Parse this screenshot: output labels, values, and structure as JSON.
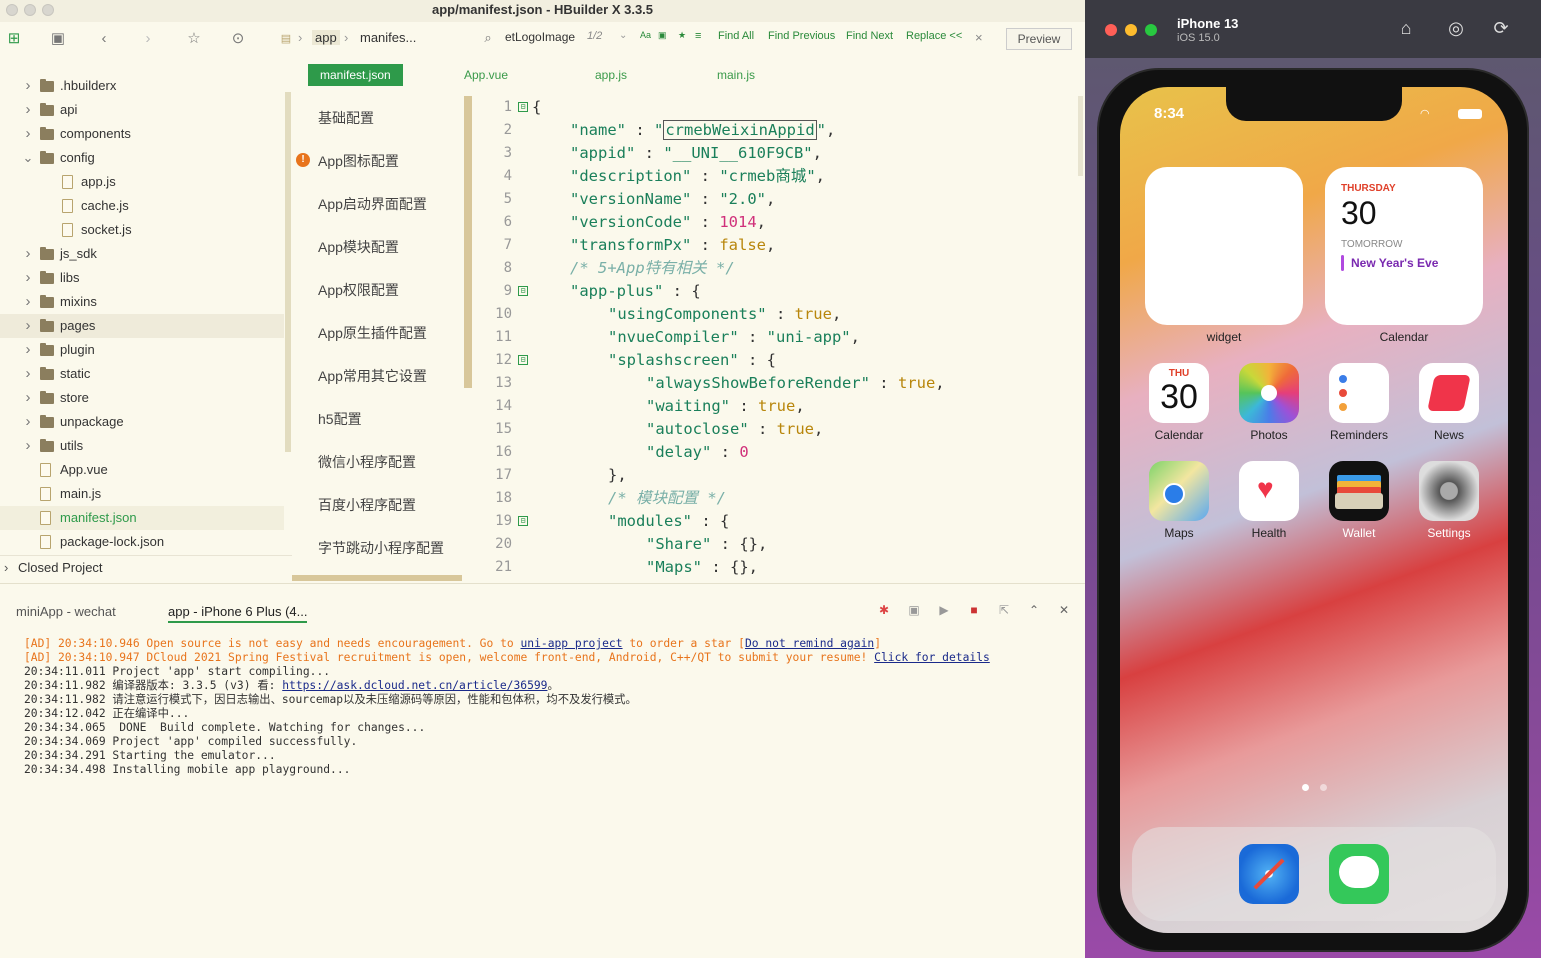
{
  "window": {
    "title": "app/manifest.json - HBuilder X 3.3.5"
  },
  "toolbar": {
    "breadcrumb": [
      "app",
      "manifes..."
    ],
    "search_value": "etLogoImage",
    "match_count": "1/2",
    "opts": [
      "Aa",
      "▣",
      "★",
      "≡"
    ],
    "find_all": "Find All",
    "find_prev": "Find Previous",
    "find_next": "Find Next",
    "replace": "Replace <<",
    "close": "×",
    "preview": "Preview"
  },
  "tree": {
    "items": [
      {
        "label": ".hbuilderx",
        "type": "folder",
        "depth": 0,
        "expanded": false
      },
      {
        "label": "api",
        "type": "folder",
        "depth": 0,
        "expanded": false
      },
      {
        "label": "components",
        "type": "folder",
        "depth": 0,
        "expanded": false
      },
      {
        "label": "config",
        "type": "folder",
        "depth": 0,
        "expanded": true
      },
      {
        "label": "app.js",
        "type": "file",
        "depth": 1
      },
      {
        "label": "cache.js",
        "type": "file",
        "depth": 1
      },
      {
        "label": "socket.js",
        "type": "file",
        "depth": 1
      },
      {
        "label": "js_sdk",
        "type": "folder",
        "depth": 0,
        "expanded": false
      },
      {
        "label": "libs",
        "type": "folder",
        "depth": 0,
        "expanded": false
      },
      {
        "label": "mixins",
        "type": "folder",
        "depth": 0,
        "expanded": false
      },
      {
        "label": "pages",
        "type": "folder",
        "depth": 0,
        "expanded": false,
        "hover": true
      },
      {
        "label": "plugin",
        "type": "folder",
        "depth": 0,
        "expanded": false
      },
      {
        "label": "static",
        "type": "folder",
        "depth": 0,
        "expanded": false
      },
      {
        "label": "store",
        "type": "folder",
        "depth": 0,
        "expanded": false
      },
      {
        "label": "unpackage",
        "type": "folder",
        "depth": 0,
        "expanded": false
      },
      {
        "label": "utils",
        "type": "folder",
        "depth": 0,
        "expanded": false
      },
      {
        "label": "App.vue",
        "type": "file",
        "depth": 0
      },
      {
        "label": "main.js",
        "type": "file",
        "depth": 0
      },
      {
        "label": "manifest.json",
        "type": "file",
        "depth": 0,
        "selected": true
      },
      {
        "label": "package-lock.json",
        "type": "file",
        "depth": 0
      }
    ],
    "closed_project": "Closed Project"
  },
  "tabs": [
    {
      "label": "manifest.json",
      "active": true
    },
    {
      "label": "App.vue"
    },
    {
      "label": "app.js"
    },
    {
      "label": "main.js"
    }
  ],
  "config_nav": [
    {
      "label": "基础配置"
    },
    {
      "label": "App图标配置",
      "warning": true
    },
    {
      "label": "App启动界面配置"
    },
    {
      "label": "App模块配置"
    },
    {
      "label": "App权限配置"
    },
    {
      "label": "App原生插件配置"
    },
    {
      "label": "App常用其它设置"
    },
    {
      "label": "h5配置"
    },
    {
      "label": "微信小程序配置"
    },
    {
      "label": "百度小程序配置"
    },
    {
      "label": "字节跳动小程序配置"
    }
  ],
  "code": [
    {
      "n": "1",
      "fold": "⊟",
      "indent": 0,
      "parts": [
        [
          "p",
          "{"
        ]
      ]
    },
    {
      "n": "2",
      "indent": 1,
      "parts": [
        [
          "k",
          "\"name\""
        ],
        [
          "p",
          " : "
        ],
        [
          "s",
          "\""
        ],
        [
          "hl",
          "crmebWeixinAppid"
        ],
        [
          "s",
          "\""
        ],
        [
          "p",
          ","
        ]
      ]
    },
    {
      "n": "3",
      "indent": 1,
      "parts": [
        [
          "k",
          "\"appid\""
        ],
        [
          "p",
          " : "
        ],
        [
          "s",
          "\"__UNI__610F9CB\""
        ],
        [
          "p",
          ","
        ]
      ]
    },
    {
      "n": "4",
      "indent": 1,
      "parts": [
        [
          "k",
          "\"description\""
        ],
        [
          "p",
          " : "
        ],
        [
          "s",
          "\"crmeb商城\""
        ],
        [
          "p",
          ","
        ]
      ]
    },
    {
      "n": "5",
      "indent": 1,
      "parts": [
        [
          "k",
          "\"versionName\""
        ],
        [
          "p",
          " : "
        ],
        [
          "s",
          "\"2.0\""
        ],
        [
          "p",
          ","
        ]
      ]
    },
    {
      "n": "6",
      "indent": 1,
      "parts": [
        [
          "k",
          "\"versionCode\""
        ],
        [
          "p",
          " : "
        ],
        [
          "n",
          "1014"
        ],
        [
          "p",
          ","
        ]
      ]
    },
    {
      "n": "7",
      "indent": 1,
      "parts": [
        [
          "k",
          "\"transformPx\""
        ],
        [
          "p",
          " : "
        ],
        [
          "b",
          "false"
        ],
        [
          "p",
          ","
        ]
      ]
    },
    {
      "n": "8",
      "indent": 1,
      "parts": [
        [
          "c",
          "/* 5+App特有相关 */"
        ]
      ]
    },
    {
      "n": "9",
      "fold": "⊟",
      "indent": 1,
      "parts": [
        [
          "k",
          "\"app-plus\""
        ],
        [
          "p",
          " : {"
        ]
      ]
    },
    {
      "n": "10",
      "indent": 2,
      "parts": [
        [
          "k",
          "\"usingComponents\""
        ],
        [
          "p",
          " : "
        ],
        [
          "b",
          "true"
        ],
        [
          "p",
          ","
        ]
      ]
    },
    {
      "n": "11",
      "indent": 2,
      "parts": [
        [
          "k",
          "\"nvueCompiler\""
        ],
        [
          "p",
          " : "
        ],
        [
          "s",
          "\"uni-app\""
        ],
        [
          "p",
          ","
        ]
      ]
    },
    {
      "n": "12",
      "fold": "⊟",
      "indent": 2,
      "parts": [
        [
          "k",
          "\"splashscreen\""
        ],
        [
          "p",
          " : {"
        ]
      ]
    },
    {
      "n": "13",
      "indent": 3,
      "parts": [
        [
          "k",
          "\"alwaysShowBeforeRender\""
        ],
        [
          "p",
          " : "
        ],
        [
          "b",
          "true"
        ],
        [
          "p",
          ","
        ]
      ]
    },
    {
      "n": "14",
      "indent": 3,
      "parts": [
        [
          "k",
          "\"waiting\""
        ],
        [
          "p",
          " : "
        ],
        [
          "b",
          "true"
        ],
        [
          "p",
          ","
        ]
      ]
    },
    {
      "n": "15",
      "indent": 3,
      "parts": [
        [
          "k",
          "\"autoclose\""
        ],
        [
          "p",
          " : "
        ],
        [
          "b",
          "true"
        ],
        [
          "p",
          ","
        ]
      ]
    },
    {
      "n": "16",
      "indent": 3,
      "parts": [
        [
          "k",
          "\"delay\""
        ],
        [
          "p",
          " : "
        ],
        [
          "n",
          "0"
        ]
      ]
    },
    {
      "n": "17",
      "indent": 2,
      "parts": [
        [
          "p",
          "},"
        ]
      ]
    },
    {
      "n": "18",
      "indent": 2,
      "parts": [
        [
          "c",
          "/* 模块配置 */"
        ]
      ]
    },
    {
      "n": "19",
      "fold": "⊟",
      "indent": 2,
      "parts": [
        [
          "k",
          "\"modules\""
        ],
        [
          "p",
          " : {"
        ]
      ]
    },
    {
      "n": "20",
      "indent": 3,
      "parts": [
        [
          "k",
          "\"Share\""
        ],
        [
          "p",
          " : {},"
        ]
      ]
    },
    {
      "n": "21",
      "indent": 3,
      "parts": [
        [
          "k",
          "\"Maps\""
        ],
        [
          "p",
          " : {},"
        ]
      ]
    }
  ],
  "console_tabs": [
    {
      "label": "miniApp - wechat"
    },
    {
      "label": "app - iPhone 6 Plus (4...",
      "active": true
    }
  ],
  "console": [
    {
      "cls": "ad",
      "parts": [
        [
          "t",
          "[AD] 20:34:10.946 Open source is not easy and needs encouragement. Go to "
        ],
        [
          "l",
          "uni-app project"
        ],
        [
          "t",
          " to order a star ["
        ],
        [
          "l",
          "Do not remind again"
        ],
        [
          "t",
          "]"
        ]
      ]
    },
    {
      "cls": "ad",
      "parts": [
        [
          "t",
          "[AD] 20:34:10.947 DCloud 2021 Spring Festival recruitment is open, welcome front-end, Android, C++/QT to submit your resume! "
        ],
        [
          "l",
          "Click for details"
        ]
      ]
    },
    {
      "parts": [
        [
          "t",
          "20:34:11.011 Project 'app' start compiling..."
        ]
      ]
    },
    {
      "parts": [
        [
          "t",
          "20:34:11.982 编译器版本: 3.3.5 (v3) 看: "
        ],
        [
          "l",
          "https://ask.dcloud.net.cn/article/36599"
        ],
        [
          "t",
          "。"
        ]
      ]
    },
    {
      "parts": [
        [
          "t",
          "20:34:11.982 请注意运行模式下，因日志输出、sourcemap以及未压缩源码等原因，性能和包体积，均不及发行模式。"
        ]
      ]
    },
    {
      "parts": [
        [
          "t",
          "20:34:12.042 正在编译中..."
        ]
      ]
    },
    {
      "parts": [
        [
          "t",
          "20:34:34.065  DONE  Build complete. Watching for changes..."
        ]
      ]
    },
    {
      "parts": [
        [
          "t",
          "20:34:34.069 Project 'app' compiled successfully."
        ]
      ]
    },
    {
      "parts": [
        [
          "t",
          "20:34:34.291 Starting the emulator..."
        ]
      ]
    },
    {
      "parts": [
        [
          "t",
          "20:34:34.498 Installing mobile app playground..."
        ]
      ]
    }
  ],
  "simulator": {
    "title": "iPhone 13",
    "subtitle": "iOS 15.0",
    "status_time": "8:34",
    "widget_label": "widget",
    "calendar_widget": {
      "day": "THURSDAY",
      "date": "30",
      "tomorrow": "TOMORROW",
      "event": "New Year's Eve",
      "label": "Calendar"
    },
    "cal_icon": {
      "day": "THU",
      "date": "30"
    },
    "apps_row1": [
      "Calendar",
      "Photos",
      "Reminders",
      "News"
    ],
    "apps_row2": [
      "Maps",
      "Health",
      "Wallet",
      "Settings"
    ],
    "dock": [
      "Safari",
      "Messages"
    ]
  }
}
